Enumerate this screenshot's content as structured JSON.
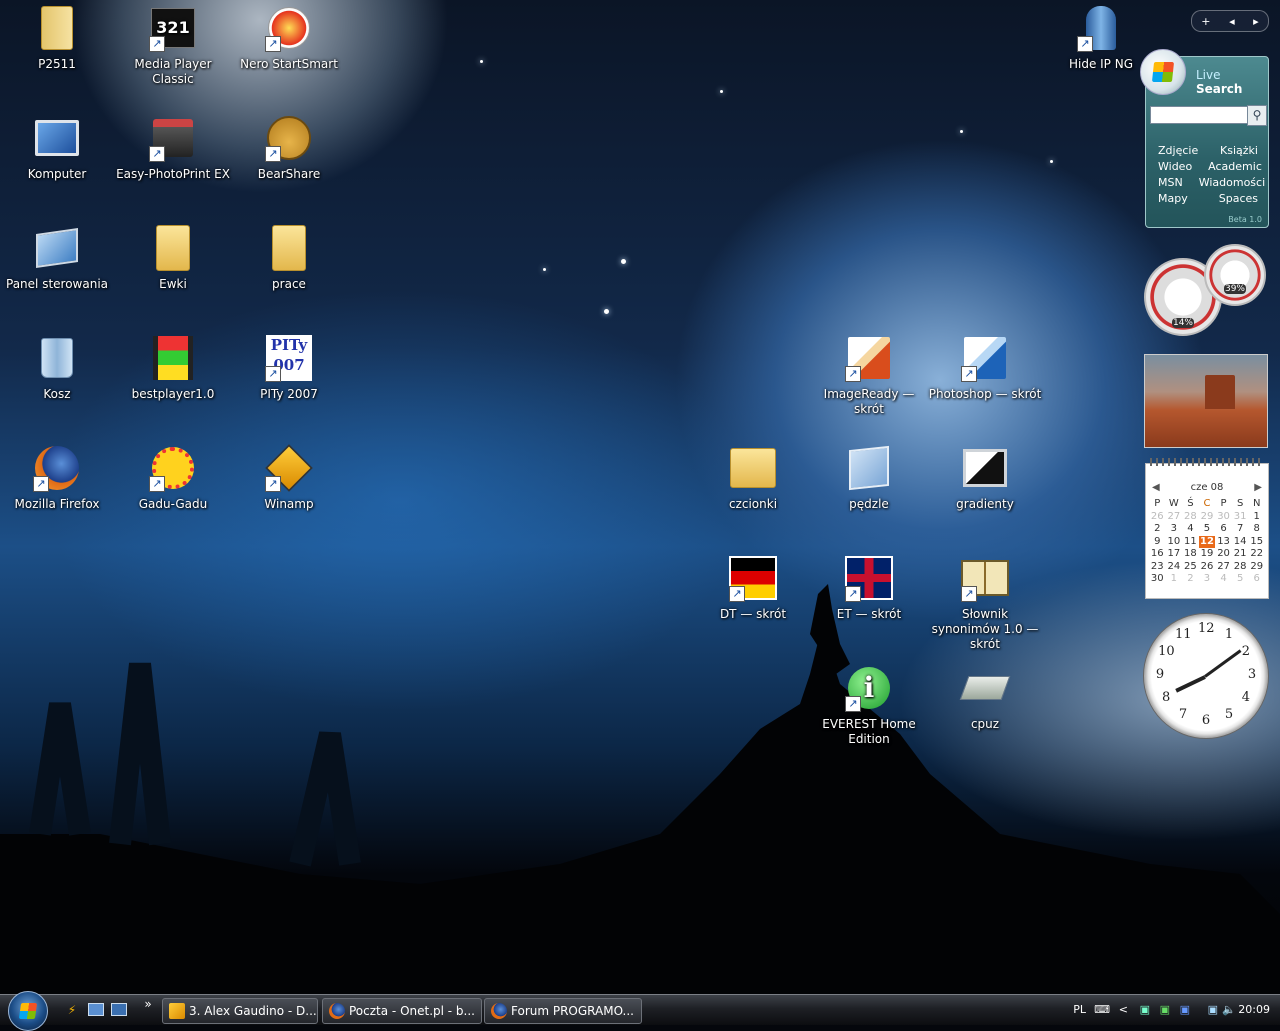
{
  "desktop_icons": [
    {
      "label": "P2511",
      "icon": "folder-zip-icon"
    },
    {
      "label": "Media Player Classic",
      "icon": "media-player-icon"
    },
    {
      "label": "Nero StartSmart",
      "icon": "nero-icon"
    },
    {
      "label": "Komputer",
      "icon": "computer-icon"
    },
    {
      "label": "Easy-PhotoPrint EX",
      "icon": "printer-icon"
    },
    {
      "label": "BearShare",
      "icon": "bear-icon"
    },
    {
      "label": "Panel sterowania",
      "icon": "control-panel-icon"
    },
    {
      "label": "Ewki",
      "icon": "folder-icon"
    },
    {
      "label": "prace",
      "icon": "folder-icon"
    },
    {
      "label": "Kosz",
      "icon": "recycle-bin-icon"
    },
    {
      "label": "bestplayer1.0",
      "icon": "film-icon"
    },
    {
      "label": "PITy 2007",
      "icon": "pity-icon"
    },
    {
      "label": "Mozilla Firefox",
      "icon": "firefox-icon"
    },
    {
      "label": "Gadu-Gadu",
      "icon": "gadu-gadu-icon"
    },
    {
      "label": "Winamp",
      "icon": "winamp-icon"
    },
    {
      "label": "Hide IP NG",
      "icon": "hide-ip-icon"
    },
    {
      "label": "ImageReady — skrót",
      "icon": "imageready-icon"
    },
    {
      "label": "Photoshop — skrót",
      "icon": "photoshop-icon"
    },
    {
      "label": "czcionki",
      "icon": "fonts-folder-icon"
    },
    {
      "label": "pędzle",
      "icon": "brushes-icon"
    },
    {
      "label": "gradienty",
      "icon": "monitor-icon"
    },
    {
      "label": "DT — skrót",
      "icon": "flag-de-icon"
    },
    {
      "label": "ET — skrót",
      "icon": "flag-uk-icon"
    },
    {
      "label": "Słownik synonimów 1.0 — skrót",
      "icon": "book-icon"
    },
    {
      "label": "EVEREST Home Edition",
      "icon": "everest-icon"
    },
    {
      "label": "cpuz",
      "icon": "cpuz-icon"
    }
  ],
  "sidebar": {
    "add_label": "+",
    "prev_label": "◂",
    "next_label": "▸"
  },
  "live_search": {
    "title_prefix": "Live",
    "title_suffix": "Search",
    "input_value": "",
    "links": [
      [
        "Zdjęcie",
        "Książki"
      ],
      [
        "Wideo",
        "Academic"
      ],
      [
        "MSN",
        "Wiadomości"
      ],
      [
        "Mapy",
        "Spaces"
      ]
    ],
    "beta_label": "Beta 1.0"
  },
  "cpu_meter": {
    "cpu_percent_label": "14%",
    "memory_percent_label": "39%"
  },
  "calendar": {
    "month_label": "cze 08",
    "weekdays": [
      "P",
      "W",
      "Ś",
      "C",
      "P",
      "S",
      "N"
    ],
    "today": 12,
    "prev_month_days": [
      26,
      27,
      28,
      29,
      30,
      31
    ],
    "days": [
      1,
      2,
      3,
      4,
      5,
      6,
      7,
      8,
      9,
      10,
      11,
      12,
      13,
      14,
      15,
      16,
      17,
      18,
      19,
      20,
      21,
      22,
      23,
      24,
      25,
      26,
      27,
      28,
      29,
      30
    ],
    "next_month_days": [
      1,
      2,
      3,
      4,
      5,
      6
    ]
  },
  "clock": {
    "numerals": [
      "12",
      "1",
      "2",
      "3",
      "4",
      "5",
      "6",
      "7",
      "8",
      "9",
      "10",
      "11"
    ],
    "hour": 8,
    "minute": 9
  },
  "taskbar": {
    "buttons": [
      {
        "label": "3. Alex Gaudino - D...",
        "icon": "winamp-icon"
      },
      {
        "label": "Poczta - Onet.pl - b...",
        "icon": "firefox-icon"
      },
      {
        "label": "Forum PROGRAMO...",
        "icon": "firefox-icon"
      }
    ],
    "more_label": "»",
    "language": "PL",
    "tray_expand": "<",
    "time": "20:09"
  },
  "colors": {
    "live_search_bg": "#2c6168",
    "today_highlight": "#e96a1a",
    "taskbar_bg": "#1e2025"
  }
}
